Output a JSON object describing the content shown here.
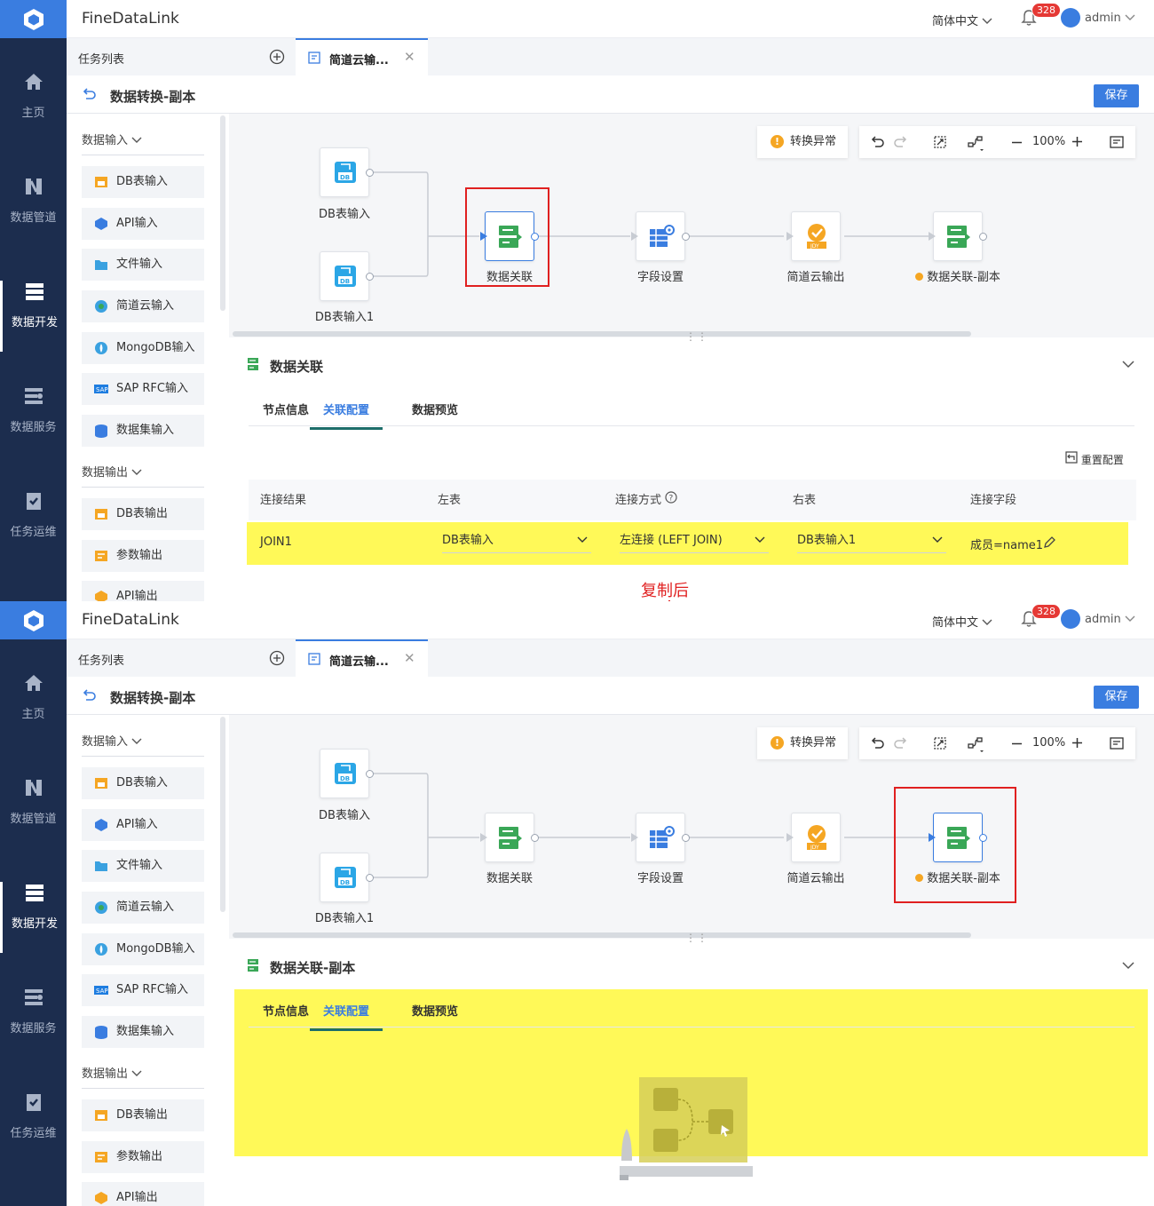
{
  "app_title": "FineDataLink",
  "top": {
    "language": "简体中文",
    "notif_count": "328",
    "user": "admin"
  },
  "nav": [
    {
      "label": "主页"
    },
    {
      "label": "数据管道"
    },
    {
      "label": "数据开发"
    },
    {
      "label": "数据服务"
    },
    {
      "label": "任务运维"
    }
  ],
  "tabbar": {
    "task_list": "任务列表",
    "tab_label": "简道云输..."
  },
  "page_title": "数据转换-副本",
  "save_label": "保存",
  "sidebar": {
    "input_title": "数据输入",
    "inputs": [
      "DB表输入",
      "API输入",
      "文件输入",
      "简道云输入",
      "MongoDB输入",
      "SAP RFC输入",
      "数据集输入"
    ],
    "output_title": "数据输出",
    "outputs": [
      "DB表输出",
      "参数输出",
      "API输出"
    ]
  },
  "canvas": {
    "warn_label": "转换异常",
    "zoom": "100%",
    "nodes": {
      "db1": "DB表输入",
      "db2": "DB表输入1",
      "join": "数据关联",
      "field": "字段设置",
      "jdy": "简道云输出",
      "copy": "数据关联-副本"
    }
  },
  "panel1": {
    "title": "数据关联",
    "tabs": [
      "节点信息",
      "关联配置",
      "数据预览"
    ],
    "reset_label": "重置配置",
    "headers": [
      "连接结果",
      "左表",
      "连接方式",
      "右表",
      "连接字段"
    ],
    "row": {
      "result": "JOIN1",
      "left": "DB表输入",
      "method": "左连接 (LEFT JOIN)",
      "right": "DB表输入1",
      "field": "成员=name1"
    }
  },
  "panel2": {
    "title": "数据关联-副本",
    "tabs": [
      "节点信息",
      "关联配置",
      "数据预览"
    ]
  },
  "annotation": "复制后",
  "colors": {
    "accent": "#3a7de0",
    "nav_bg": "#1c2d4e",
    "highlight": "#fff94f",
    "annotation": "#e02020",
    "join_green": "#3aa757",
    "jdy_orange": "#f5a623"
  }
}
